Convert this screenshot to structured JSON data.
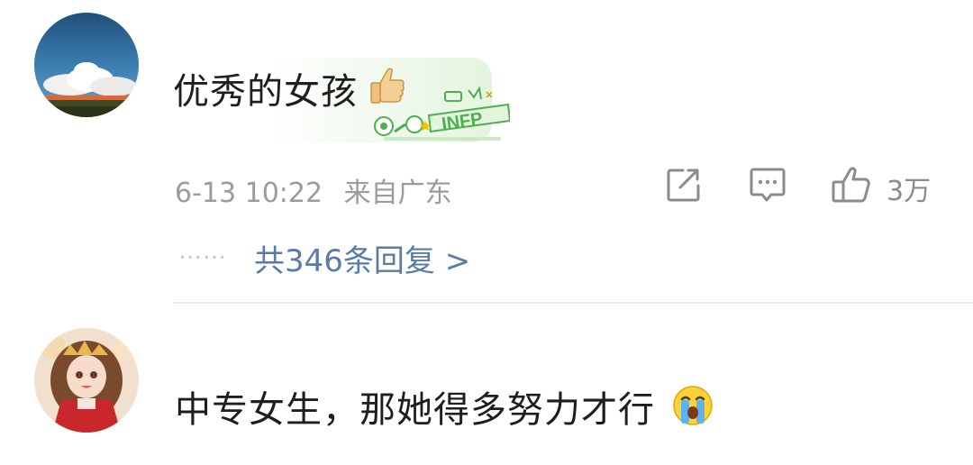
{
  "comments": [
    {
      "text": "优秀的女孩",
      "emoji": "thumbs-up",
      "badge": {
        "label": "INFP"
      },
      "date": "6-13 10:22",
      "location": "来自广东",
      "like_count": "3万",
      "replies_dots": "……",
      "replies_label": "共346条回复 >"
    },
    {
      "text": "中专女生，那她得多努力才行",
      "emoji": "crying-face"
    }
  ],
  "colors": {
    "link": "#5a7ba8",
    "meta_text": "#9b9b9b",
    "badge_green": "#4caf50",
    "divider": "#ececec"
  }
}
